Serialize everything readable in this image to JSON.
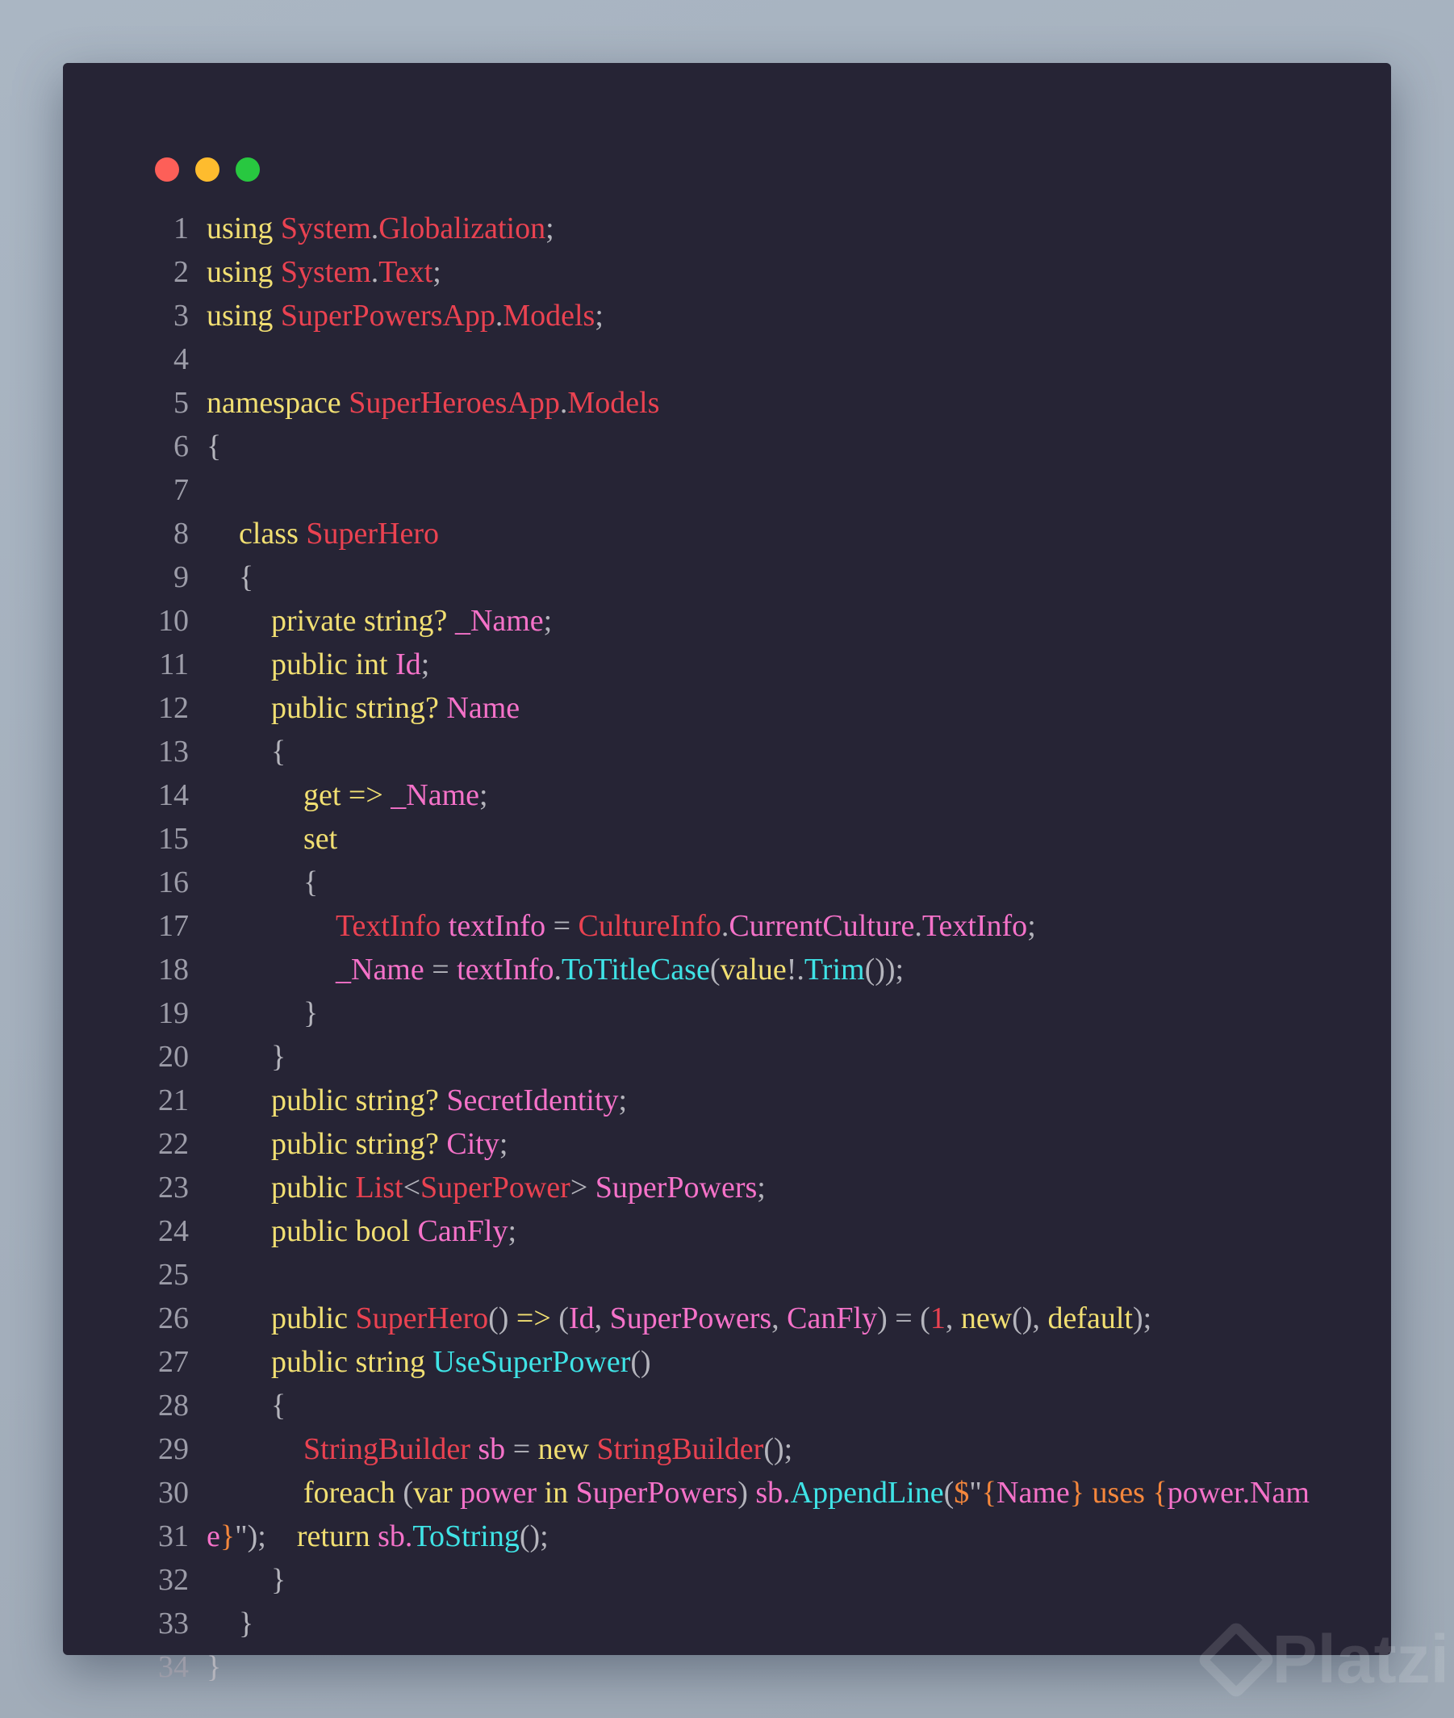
{
  "window": {
    "controls": [
      "close",
      "minimize",
      "maximize"
    ],
    "colors": {
      "close": "#fd5f58",
      "minimize": "#febc2e",
      "maximize": "#28c840",
      "background": "#262435"
    }
  },
  "colors": {
    "keyword": "#f1df72",
    "type": "#ea4251",
    "identifier": "#f572c9",
    "method": "#3fe3e6",
    "punct": "#b4b4bc",
    "string": "#f5873c"
  },
  "code": {
    "lines": [
      {
        "n": "1",
        "indent": 0,
        "tokens": [
          [
            "k",
            "using "
          ],
          [
            "r",
            "System"
          ],
          [
            "g",
            "."
          ],
          [
            "r",
            "Globalization"
          ],
          [
            "g",
            ";"
          ]
        ]
      },
      {
        "n": "2",
        "indent": 0,
        "tokens": [
          [
            "k",
            "using "
          ],
          [
            "r",
            "System"
          ],
          [
            "g",
            "."
          ],
          [
            "r",
            "Text"
          ],
          [
            "g",
            ";"
          ]
        ]
      },
      {
        "n": "3",
        "indent": 0,
        "tokens": [
          [
            "k",
            "using "
          ],
          [
            "r",
            "SuperPowersApp"
          ],
          [
            "g",
            "."
          ],
          [
            "r",
            "Models"
          ],
          [
            "g",
            ";"
          ]
        ]
      },
      {
        "n": "4",
        "indent": 0,
        "tokens": []
      },
      {
        "n": "5",
        "indent": 0,
        "tokens": [
          [
            "k",
            "namespace "
          ],
          [
            "r",
            "SuperHeroesApp"
          ],
          [
            "g",
            "."
          ],
          [
            "r",
            "Models"
          ]
        ]
      },
      {
        "n": "6",
        "indent": 0,
        "tokens": [
          [
            "g",
            "{"
          ]
        ]
      },
      {
        "n": "7",
        "indent": 0,
        "tokens": []
      },
      {
        "n": "8",
        "indent": 1,
        "tokens": [
          [
            "k",
            "class "
          ],
          [
            "r",
            "SuperHero"
          ]
        ]
      },
      {
        "n": "9",
        "indent": 1,
        "tokens": [
          [
            "g",
            "{"
          ]
        ]
      },
      {
        "n": "10",
        "indent": 2,
        "tokens": [
          [
            "k",
            "private string? "
          ],
          [
            "p",
            "_Name"
          ],
          [
            "g",
            ";"
          ]
        ]
      },
      {
        "n": "11",
        "indent": 2,
        "tokens": [
          [
            "k",
            "public int "
          ],
          [
            "p",
            "Id"
          ],
          [
            "g",
            ";"
          ]
        ]
      },
      {
        "n": "12",
        "indent": 2,
        "tokens": [
          [
            "k",
            "public string? "
          ],
          [
            "p",
            "Name"
          ]
        ]
      },
      {
        "n": "13",
        "indent": 2,
        "tokens": [
          [
            "g",
            "{"
          ]
        ]
      },
      {
        "n": "14",
        "indent": 3,
        "tokens": [
          [
            "k",
            "get => "
          ],
          [
            "p",
            "_Name"
          ],
          [
            "g",
            ";"
          ]
        ]
      },
      {
        "n": "15",
        "indent": 3,
        "tokens": [
          [
            "k",
            "set"
          ]
        ]
      },
      {
        "n": "16",
        "indent": 3,
        "tokens": [
          [
            "g",
            "{"
          ]
        ]
      },
      {
        "n": "17",
        "indent": 4,
        "tokens": [
          [
            "r",
            "TextInfo"
          ],
          [
            "p",
            " textInfo "
          ],
          [
            "g",
            "= "
          ],
          [
            "r",
            "CultureInfo"
          ],
          [
            "g",
            "."
          ],
          [
            "p",
            "CurrentCulture"
          ],
          [
            "g",
            "."
          ],
          [
            "p",
            "TextInfo"
          ],
          [
            "g",
            ";"
          ]
        ]
      },
      {
        "n": "18",
        "indent": 4,
        "tokens": [
          [
            "p",
            "_Name "
          ],
          [
            "g",
            "= "
          ],
          [
            "p",
            "textInfo"
          ],
          [
            "g",
            "."
          ],
          [
            "c",
            "ToTitleCase"
          ],
          [
            "g",
            "("
          ],
          [
            "k",
            "value"
          ],
          [
            "g",
            "!."
          ],
          [
            "c",
            "Trim"
          ],
          [
            "g",
            "());"
          ]
        ]
      },
      {
        "n": "19",
        "indent": 3,
        "tokens": [
          [
            "g",
            "}"
          ]
        ]
      },
      {
        "n": "20",
        "indent": 2,
        "tokens": [
          [
            "g",
            "}"
          ]
        ]
      },
      {
        "n": "21",
        "indent": 2,
        "tokens": [
          [
            "k",
            "public string? "
          ],
          [
            "p",
            "SecretIdentity"
          ],
          [
            "g",
            ";"
          ]
        ]
      },
      {
        "n": "22",
        "indent": 2,
        "tokens": [
          [
            "k",
            "public string? "
          ],
          [
            "p",
            "City"
          ],
          [
            "g",
            ";"
          ]
        ]
      },
      {
        "n": "23",
        "indent": 2,
        "tokens": [
          [
            "k",
            "public "
          ],
          [
            "r",
            "List"
          ],
          [
            "g",
            "<"
          ],
          [
            "r",
            "SuperPower"
          ],
          [
            "g",
            "> "
          ],
          [
            "p",
            "SuperPowers"
          ],
          [
            "g",
            ";"
          ]
        ]
      },
      {
        "n": "24",
        "indent": 2,
        "tokens": [
          [
            "k",
            "public bool "
          ],
          [
            "p",
            "CanFly"
          ],
          [
            "g",
            ";"
          ]
        ]
      },
      {
        "n": "25",
        "indent": 0,
        "tokens": []
      },
      {
        "n": "26",
        "indent": 2,
        "tokens": [
          [
            "k",
            "public "
          ],
          [
            "r",
            "SuperHero"
          ],
          [
            "g",
            "() "
          ],
          [
            "k",
            "=> "
          ],
          [
            "g",
            "("
          ],
          [
            "p",
            "Id"
          ],
          [
            "g",
            ", "
          ],
          [
            "p",
            "SuperPowers"
          ],
          [
            "g",
            ", "
          ],
          [
            "p",
            "CanFly"
          ],
          [
            "g",
            ") = ("
          ],
          [
            "r",
            "1"
          ],
          [
            "g",
            ", "
          ],
          [
            "k",
            "new"
          ],
          [
            "g",
            "(), "
          ],
          [
            "k",
            "default"
          ],
          [
            "g",
            ");"
          ]
        ]
      },
      {
        "n": "27",
        "indent": 2,
        "tokens": [
          [
            "k",
            "public string "
          ],
          [
            "c",
            "UseSuperPower"
          ],
          [
            "g",
            "()"
          ]
        ]
      },
      {
        "n": "28",
        "indent": 2,
        "tokens": [
          [
            "g",
            "{"
          ]
        ]
      },
      {
        "n": "29",
        "indent": 3,
        "tokens": [
          [
            "r",
            "StringBuilder"
          ],
          [
            "p",
            " sb "
          ],
          [
            "g",
            "= "
          ],
          [
            "k",
            "new "
          ],
          [
            "r",
            "StringBuilder"
          ],
          [
            "g",
            "();"
          ]
        ]
      },
      {
        "n": "30",
        "indent": 3,
        "tokens": [
          [
            "k",
            "foreach "
          ],
          [
            "g",
            "("
          ],
          [
            "k",
            "var "
          ],
          [
            "p",
            "power "
          ],
          [
            "k",
            "in "
          ],
          [
            "p",
            "SuperPowers"
          ],
          [
            "g",
            ") "
          ],
          [
            "p",
            "sb."
          ],
          [
            "c",
            "AppendLine"
          ],
          [
            "g",
            "("
          ],
          [
            "o",
            "$"
          ],
          [
            "g",
            "\""
          ],
          [
            "o",
            "{"
          ],
          [
            "p",
            "Name"
          ],
          [
            "o",
            "}"
          ],
          [
            "o",
            " uses "
          ],
          [
            "o",
            "{"
          ],
          [
            "p",
            "power.Nam"
          ]
        ]
      },
      {
        "n": "31",
        "indent": 0,
        "tokens": [
          [
            "p",
            "e"
          ],
          [
            "o",
            "}"
          ],
          [
            "g",
            "\");    "
          ],
          [
            "k",
            "return "
          ],
          [
            "p",
            "sb."
          ],
          [
            "c",
            "ToString"
          ],
          [
            "g",
            "();"
          ]
        ]
      },
      {
        "n": "32",
        "indent": 2,
        "tokens": [
          [
            "g",
            "}"
          ]
        ]
      },
      {
        "n": "33",
        "indent": 1,
        "tokens": [
          [
            "g",
            "}"
          ]
        ]
      },
      {
        "n": "34",
        "indent": 0,
        "tokens": [
          [
            "g",
            "}"
          ]
        ]
      }
    ]
  },
  "watermark": "Platzi"
}
